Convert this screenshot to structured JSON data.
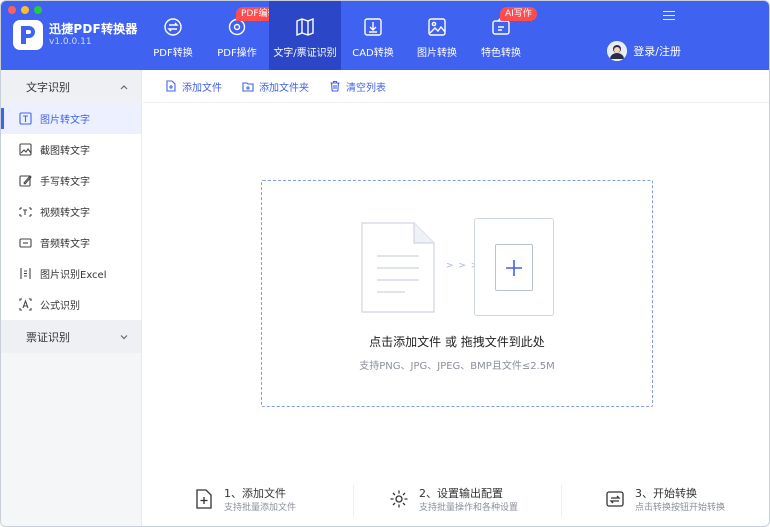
{
  "app": {
    "name": "迅捷PDF转换器",
    "version": "v1.0.0.11"
  },
  "nav": {
    "items": [
      {
        "label": "PDF转换",
        "icon": "convert-icon"
      },
      {
        "label": "PDF操作",
        "icon": "gear-doc-icon",
        "badge": "PDF编辑"
      },
      {
        "label": "文字/票证识别",
        "icon": "ocr-icon",
        "active": true
      },
      {
        "label": "CAD转换",
        "icon": "cad-icon"
      },
      {
        "label": "图片转换",
        "icon": "image-icon"
      },
      {
        "label": "特色转换",
        "icon": "ai-icon",
        "badge": "AI写作"
      }
    ]
  },
  "user": {
    "login_label": "登录/注册"
  },
  "sidebar": {
    "group1": "文字识别",
    "items": [
      {
        "label": "图片转文字",
        "icon": "text-icon",
        "active": true
      },
      {
        "label": "截图转文字",
        "icon": "screenshot-icon"
      },
      {
        "label": "手写转文字",
        "icon": "handwrite-icon"
      },
      {
        "label": "视频转文字",
        "icon": "video-icon"
      },
      {
        "label": "音频转文字",
        "icon": "audio-icon"
      },
      {
        "label": "图片识别Excel",
        "icon": "excel-icon"
      },
      {
        "label": "公式识别",
        "icon": "formula-icon"
      }
    ],
    "group2": "票证识别"
  },
  "toolbar": {
    "add_file": "添加文件",
    "add_folder": "添加文件夹",
    "clear_list": "清空列表"
  },
  "dropzone": {
    "arrows": "> > >",
    "title": "点击添加文件 或 拖拽文件到此处",
    "subtitle": "支持PNG、JPG、JPEG、BMP且文件≤2.5M"
  },
  "steps": [
    {
      "title": "1、添加文件",
      "sub": "支持批量添加文件"
    },
    {
      "title": "2、设置输出配置",
      "sub": "支持批量操作和各种设置"
    },
    {
      "title": "3、开始转换",
      "sub": "点击转换按钮开始转换"
    }
  ],
  "colors": {
    "accent": "#3f62f0",
    "active_nav": "#2b46c7",
    "badge": "#ff4d4f"
  }
}
